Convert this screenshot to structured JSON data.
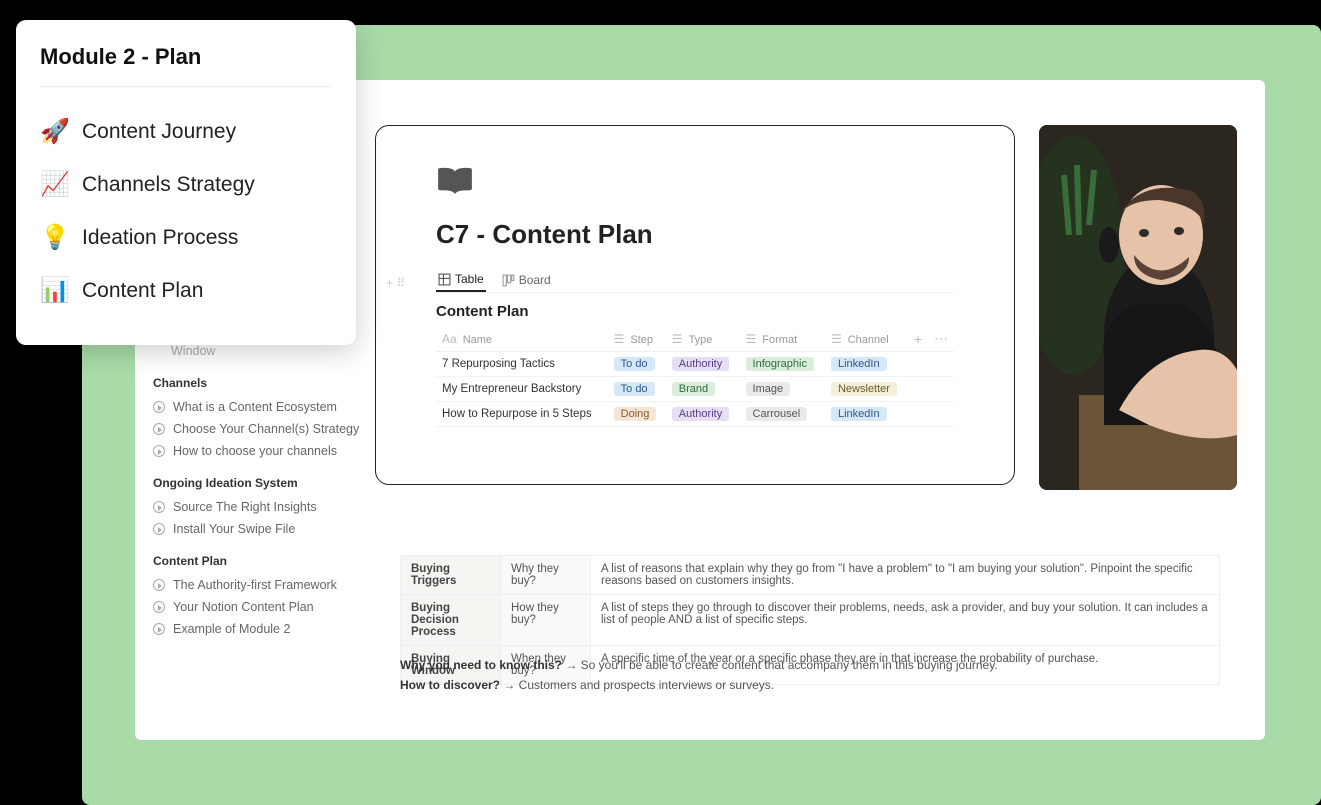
{
  "popup": {
    "title": "Module 2 - Plan",
    "items": [
      {
        "icon": "🚀",
        "label": "Content Journey"
      },
      {
        "icon": "📈",
        "label": "Channels Strategy"
      },
      {
        "icon": "💡",
        "label": "Ideation Process"
      },
      {
        "icon": "📊",
        "label": "Content Plan"
      }
    ]
  },
  "sidebar": {
    "partial_item": "Window",
    "groups": [
      {
        "title": "Channels",
        "items": [
          "What is a Content Ecosystem",
          "Choose Your Channel(s) Strategy",
          "How to choose your channels"
        ]
      },
      {
        "title": "Ongoing Ideation System",
        "items": [
          "Source The Right Insights",
          "Install Your Swipe File"
        ]
      },
      {
        "title": "Content Plan",
        "items": [
          "The Authority-first Framework",
          "Your Notion Content Plan",
          "Example of Module 2"
        ]
      }
    ]
  },
  "card": {
    "title": "C7 - Content Plan",
    "tabs": {
      "table": "Table",
      "board": "Board"
    },
    "subtitle": "Content Plan",
    "columns": {
      "name": "Name",
      "step": "Step",
      "type": "Type",
      "format": "Format",
      "channel": "Channel"
    },
    "rows": [
      {
        "name": "7 Repurposing Tactics",
        "step": "To do",
        "type": "Authority",
        "format": "Infographic",
        "channel": "LinkedIn"
      },
      {
        "name": "My Entrepreneur Backstory",
        "step": "To do",
        "type": "Brand",
        "format": "Image",
        "channel": "Newsletter"
      },
      {
        "name": "How to Repurpose in 5 Steps",
        "step": "Doing",
        "type": "Authority",
        "format": "Carrousel",
        "channel": "LinkedIn"
      }
    ],
    "tag_styles": {
      "To do": "tag-blue",
      "Doing": "tag-orange",
      "Authority": "tag-purple",
      "Brand": "tag-green",
      "Infographic": "tag-green",
      "Image": "tag-gray",
      "Carrousel": "tag-gray",
      "LinkedIn": "tag-blue",
      "Newsletter": "tag-yellow"
    }
  },
  "info": {
    "rows": [
      {
        "h": "Buying Triggers",
        "q": "Why they buy?",
        "d": "A list of reasons that explain why they go from \"I have a problem\" to \"I am buying your solution\". Pinpoint the specific reasons based on customers insights."
      },
      {
        "h": "Buying Decision Process",
        "q": "How they buy?",
        "d": "A list of steps they go through to discover their problems, needs, ask a provider, and buy your solution. It can includes a list of people AND a list of specific steps."
      },
      {
        "h": "Buying Window",
        "q": "When they buy?",
        "d": "A specific time of the year or a specific phase they are in that increase the probability of purchase."
      }
    ],
    "line1_label": "Why you need to know this?",
    "line1_text": " → So you'll be able to create content that accompany them in this buying journey.",
    "line2_label": "How to discover?",
    "line2_text": " → Customers and prospects interviews or surveys."
  }
}
